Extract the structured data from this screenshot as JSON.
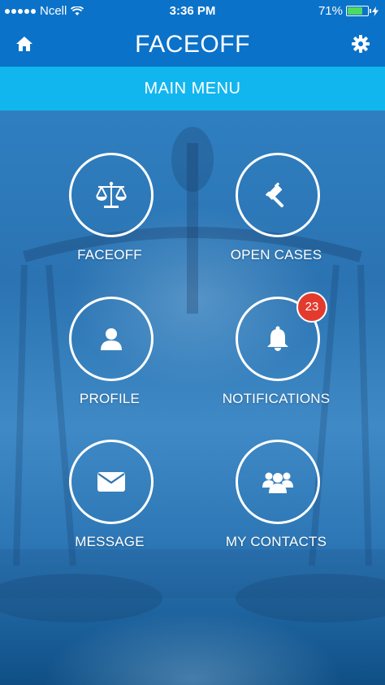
{
  "status_bar": {
    "carrier": "Ncell",
    "time": "3:36 PM",
    "battery_percent": "71%",
    "battery_level": 0.71
  },
  "header": {
    "title": "FACEOFF",
    "left_icon": "home-icon",
    "right_icon": "gear-icon",
    "color": "#0b72c9"
  },
  "subheader": {
    "title": "MAIN MENU",
    "color": "#12b6ef"
  },
  "menu": {
    "items": [
      {
        "label": "FACEOFF",
        "icon": "scales-icon"
      },
      {
        "label": "OPEN CASES",
        "icon": "gavel-icon"
      },
      {
        "label": "PROFILE",
        "icon": "user-icon"
      },
      {
        "label": "NOTIFICATIONS",
        "icon": "bell-icon",
        "badge": "23"
      },
      {
        "label": "MESSAGE",
        "icon": "envelope-icon"
      },
      {
        "label": "MY CONTACTS",
        "icon": "group-icon"
      }
    ]
  }
}
